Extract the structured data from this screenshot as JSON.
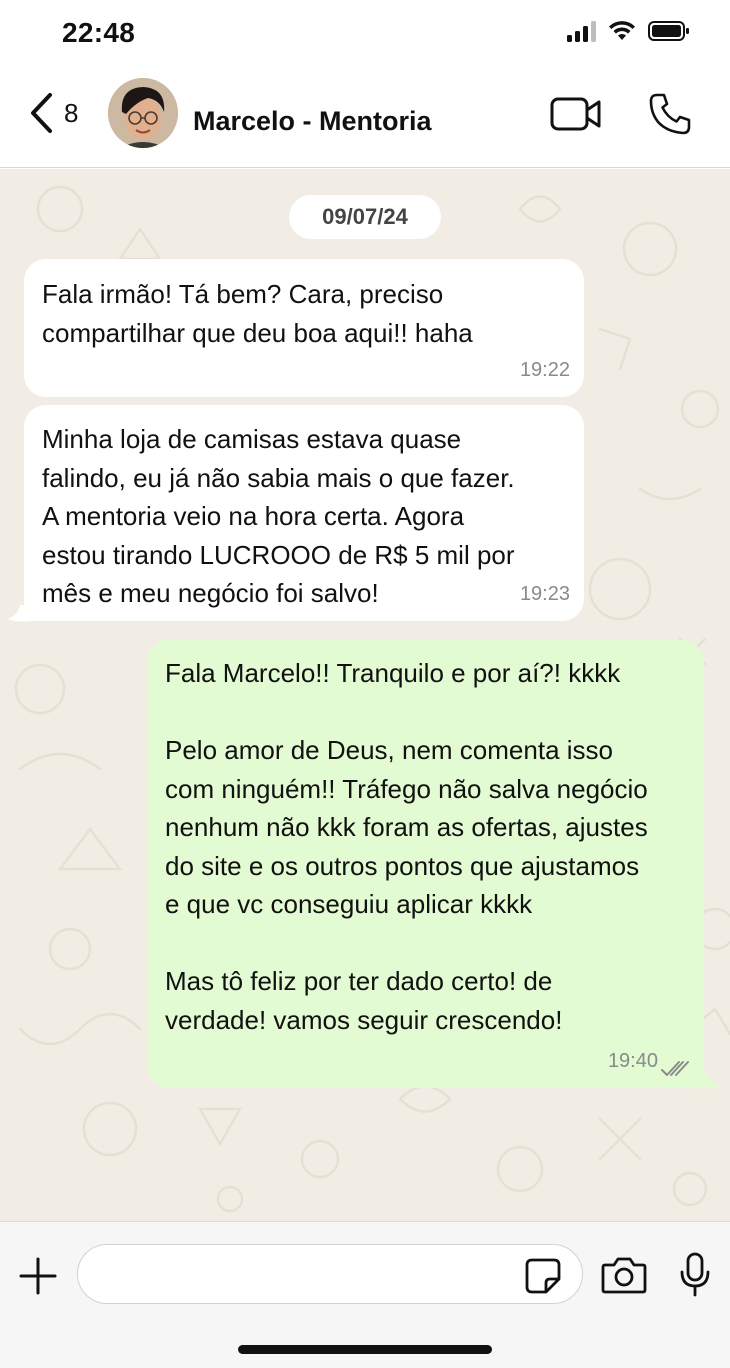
{
  "status_bar": {
    "time": "22:48"
  },
  "header": {
    "back_count": "8",
    "contact_name": "Marcelo - Mentoria"
  },
  "chat": {
    "date": "09/07/24",
    "messages": [
      {
        "direction": "in",
        "text": "Fala irmão! Tá bem? Cara, preciso\ncompartilhar que deu boa aqui!! haha",
        "time": "19:22"
      },
      {
        "direction": "in",
        "text": "Minha loja de camisas estava quase\nfalindo, eu já não sabia mais o que fazer.\nA mentoria veio na hora certa. Agora\nestou tirando LUCROOO de R$ 5 mil por\nmês e meu negócio foi salvo!",
        "time": "19:23"
      },
      {
        "direction": "out",
        "text": "Fala Marcelo!! Tranquilo e por aí?! kkkk\n\nPelo amor de Deus, nem comenta isso\ncom ninguém!! Tráfego não salva negócio\nnenhum não kkk foram as ofertas, ajustes\ndo site e os outros pontos que ajustamos\ne que vc conseguiu aplicar kkkk\n\nMas tô feliz por ter dado certo! de\nverdade! vamos seguir crescendo!",
        "time": "19:40",
        "status_icon": "double-check-icon"
      }
    ]
  },
  "composer": {
    "value": "",
    "placeholder": ""
  },
  "colors": {
    "chat_bg": "#f2ede4",
    "outgoing_bubble": "#e3fbd2",
    "incoming_bubble": "#ffffff"
  }
}
